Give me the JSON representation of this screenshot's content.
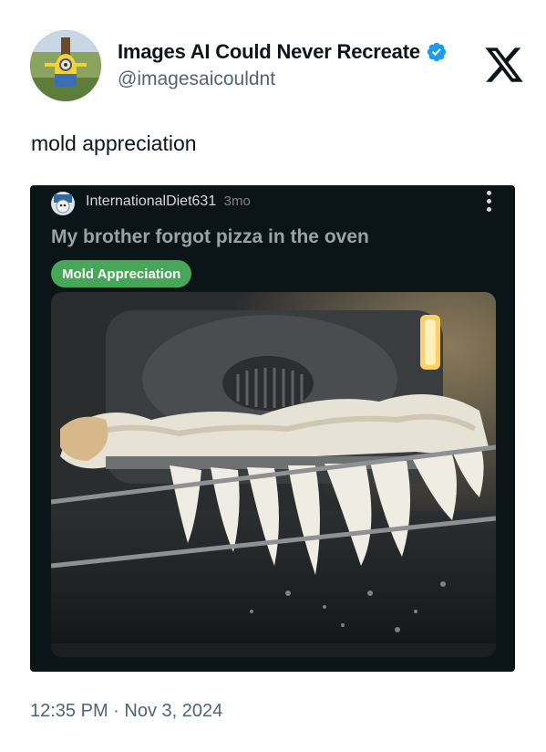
{
  "header": {
    "display_name": "Images AI Could Never Recreate",
    "handle": "@imagesaicouldnt",
    "avatar_icon": "minion-avatar-icon",
    "verified_icon": "verified-badge-icon",
    "logo_icon": "x-logo-icon",
    "verified_color": "#1d9bf0"
  },
  "tweet": {
    "text": "mold appreciation",
    "timestamp": "12:35 PM · Nov 3, 2024"
  },
  "embedded_post": {
    "username": "InternationalDiet631",
    "age": "3mo",
    "title": "My brother forgot pizza in the oven",
    "flair": "Mold Appreciation",
    "flair_color": "#46a758",
    "background_color": "#0b1416",
    "menu_icon": "more-vertical-icon"
  }
}
